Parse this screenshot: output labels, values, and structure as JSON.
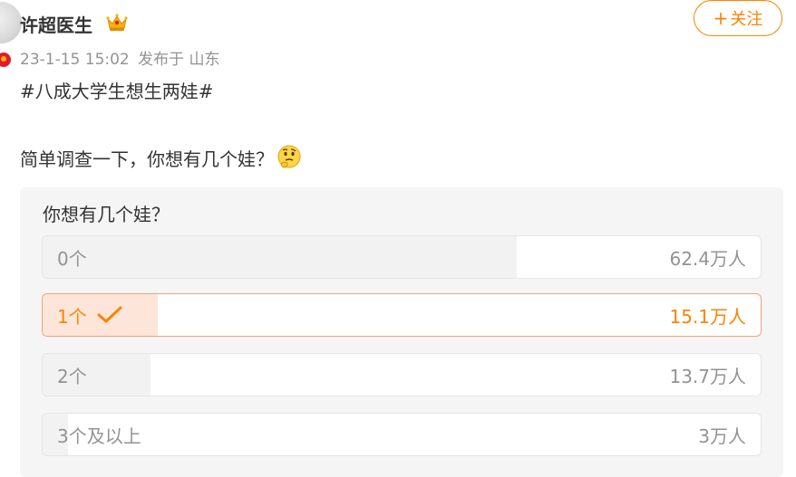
{
  "post": {
    "author": "许超医生",
    "timestamp": "23-1-15 15:02",
    "source": "发布于 山东",
    "follow_label": "关注",
    "follow_plus": "+",
    "topic": "#八成大学生想生两娃#",
    "text": "简单调查一下，你想有几个娃？"
  },
  "poll": {
    "title": "你想有几个娃？",
    "options": [
      {
        "label": "0个",
        "count": "62.4万人",
        "selected": false,
        "fill_fraction": 0.66
      },
      {
        "label": "1个",
        "count": "15.1万人",
        "selected": true,
        "fill_fraction": 0.16
      },
      {
        "label": "2个",
        "count": "13.7万人",
        "selected": false,
        "fill_fraction": 0.15
      },
      {
        "label": "3个及以上",
        "count": "3万人",
        "selected": false,
        "fill_fraction": 0.035
      }
    ]
  },
  "icons": {
    "crown": "crown-badge-icon",
    "verified": "verified-badge-icon",
    "emoji": "thinking-emoji-icon",
    "check": "checkmark-icon"
  },
  "colors": {
    "accent": "#ff8200",
    "selected_fill": "#fde6d9",
    "bar_fill": "#f2f2f2",
    "muted_text": "#939393"
  }
}
